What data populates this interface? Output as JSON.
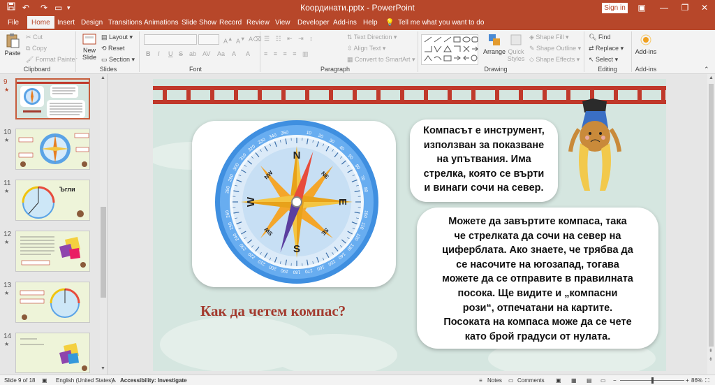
{
  "app": {
    "document_title": "Координати.pptx - PowerPoint",
    "sign_in": "Sign in"
  },
  "tabs": [
    "File",
    "Home",
    "Insert",
    "Design",
    "Transitions",
    "Animations",
    "Slide Show",
    "Record",
    "Review",
    "View",
    "Developer",
    "Add-ins",
    "Help"
  ],
  "tell_me": "Tell me what you want to do",
  "ribbon": {
    "clipboard": {
      "paste": "Paste",
      "cut": "Cut",
      "copy": "Copy",
      "format_painter": "Format Painter",
      "label": "Clipboard"
    },
    "slides": {
      "new_slide": "New Slide",
      "layout": "Layout",
      "reset": "Reset",
      "section": "Section",
      "label": "Slides"
    },
    "font": {
      "label": "Font",
      "letters": [
        "B",
        "I",
        "U",
        "S",
        "ab",
        "AV",
        "Aa",
        "A",
        "A"
      ]
    },
    "paragraph": {
      "text_direction": "Text Direction",
      "align_text": "Align Text",
      "convert_smartart": "Convert to SmartArt",
      "label": "Paragraph"
    },
    "drawing": {
      "arrange": "Arrange",
      "quick_styles": "Quick Styles",
      "shape_fill": "Shape Fill",
      "shape_outline": "Shape Outline",
      "shape_effects": "Shape Effects",
      "label": "Drawing"
    },
    "editing": {
      "find": "Find",
      "replace": "Replace",
      "select": "Select",
      "label": "Editing"
    },
    "addins": {
      "button": "Add-ins",
      "label": "Add-ins"
    }
  },
  "thumbnails": [
    {
      "num": "9",
      "selected": true
    },
    {
      "num": "10",
      "selected": false
    },
    {
      "num": "11",
      "selected": false,
      "caption": "Ъгли"
    },
    {
      "num": "12",
      "selected": false
    },
    {
      "num": "13",
      "selected": false
    },
    {
      "num": "14",
      "selected": false
    }
  ],
  "slide": {
    "bubble1": [
      "Компасът е инструмент,",
      "използван за показване",
      "на упътвания. Има",
      "стрелка, която се върти",
      "и винаги сочи на север."
    ],
    "bubble2": [
      "Можете да завъртите компаса, така",
      "че стрелката да сочи на север на",
      "циферблата. Ако знаете, че трябва да",
      "се насочите на югозапад, тогава",
      "можете да се отправите в правилната",
      "посока. Ще видите и „компасни",
      "рози“, отпечатани на картите.",
      "Посоката на компаса може да се чете",
      "като брой градуси от нулата."
    ],
    "heading": "Как да четем компас?",
    "compass": {
      "cardinals": [
        "N",
        "E",
        "S",
        "W"
      ],
      "intercardinals": [
        "NE",
        "SE",
        "SW",
        "NW"
      ],
      "degrees": [
        "10",
        "20",
        "30",
        "40",
        "50",
        "60",
        "70",
        "80",
        "100",
        "110",
        "120",
        "130",
        "140",
        "150",
        "160",
        "170",
        "180",
        "190",
        "200",
        "210",
        "220",
        "230",
        "240",
        "250",
        "260",
        "280",
        "290",
        "300",
        "310",
        "320",
        "330",
        "340",
        "350"
      ]
    }
  },
  "status": {
    "slide_info": "Slide 9 of 18",
    "language": "English (United States)",
    "accessibility": "Accessibility: Investigate",
    "notes": "Notes",
    "comments": "Comments",
    "zoom": "86%"
  },
  "colors": {
    "accent": "#b7472a",
    "heading": "#a33a2e",
    "slide_bg": "#d5e6e0",
    "ladder": "#c0392b"
  }
}
